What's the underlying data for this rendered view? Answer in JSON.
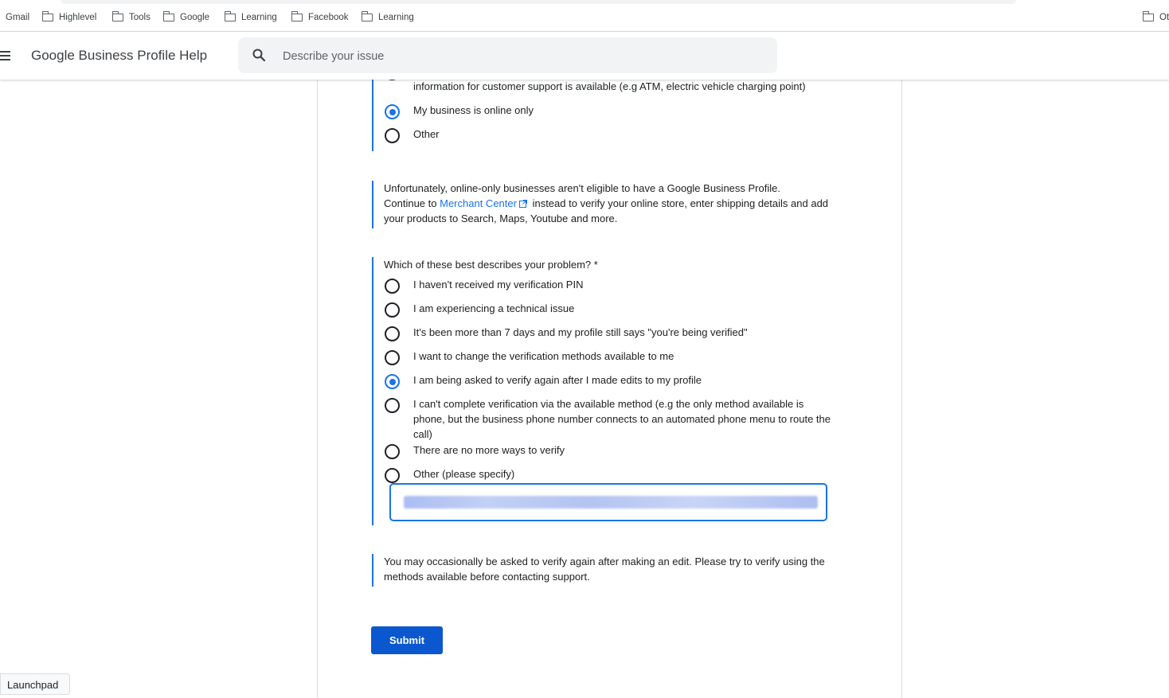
{
  "bookmarks": [
    {
      "label": "Gmail",
      "folder": false
    },
    {
      "label": "Highlevel",
      "folder": true
    },
    {
      "label": "Tools",
      "folder": true
    },
    {
      "label": "Google",
      "folder": true
    },
    {
      "label": "Learning",
      "folder": true
    },
    {
      "label": "Facebook",
      "folder": true
    },
    {
      "label": "Learning",
      "folder": true
    }
  ],
  "bookmarks_other": "Ot",
  "header": {
    "title": "Google Business Profile Help",
    "search_placeholder": "Describe your issue"
  },
  "question1": {
    "options": [
      {
        "label": "My business is an unstaffed facility where a transaction can take place and contact information for customer support is available (e.g ATM, electric vehicle charging point)",
        "checked": false
      },
      {
        "label": "My business is online only",
        "checked": true
      },
      {
        "label": "Other",
        "checked": false
      }
    ]
  },
  "notice": {
    "line1": "Unfortunately, online-only businesses aren't eligible to have a Google Business Profile.",
    "prefix": "Continue to",
    "link": "Merchant Center",
    "suffix": "instead to verify your online store, enter shipping details and add your products to Search, Maps, Youtube and more."
  },
  "question2": {
    "prompt": "Which of these best describes your problem? *",
    "options": [
      {
        "label": "I haven't received my verification PIN",
        "checked": false
      },
      {
        "label": "I am experiencing a technical issue",
        "checked": false
      },
      {
        "label": "It's been more than 7 days and my profile still says \"you're being verified\"",
        "checked": false
      },
      {
        "label": "I want to change the verification methods available to me",
        "checked": false
      },
      {
        "label": "I am being asked to verify again after I made edits to my profile",
        "checked": true
      },
      {
        "label": "I can't complete verification via the available method (e.g the only method available is phone, but the business phone number connects to an automated phone menu to route the call)",
        "checked": false
      },
      {
        "label": "There are no more ways to verify",
        "checked": false
      },
      {
        "label": "Other (please specify)",
        "checked": false
      }
    ]
  },
  "info": {
    "text": "You may occasionally be asked to verify again after making an edit. Please try to verify using the methods available before contacting support."
  },
  "submit_label": "Submit",
  "launchpad_label": "Launchpad",
  "colors": {
    "accent": "#1a73e8",
    "button": "#0b57d0"
  }
}
